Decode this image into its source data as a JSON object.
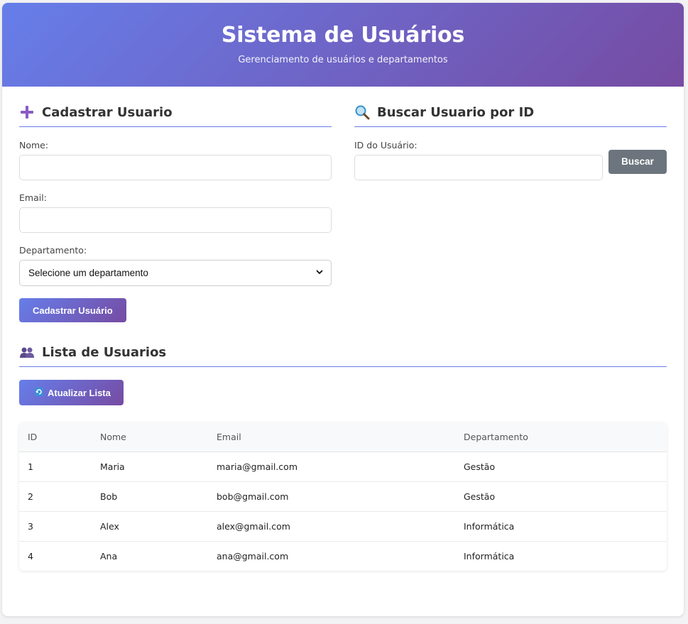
{
  "header": {
    "title": "Sistema de Usuários",
    "subtitle": "Gerenciamento de usuários e departamentos"
  },
  "register": {
    "title": "Cadastrar Usuario",
    "icon": "plus-icon",
    "name_label": "Nome:",
    "name_value": "",
    "email_label": "Email:",
    "email_value": "",
    "department_label": "Departamento:",
    "department_selected": "Selecione um departamento",
    "submit_label": "Cadastrar Usuário"
  },
  "search": {
    "title": "Buscar Usuario por ID",
    "icon": "magnifier-icon",
    "id_label": "ID do Usuário:",
    "id_value": "",
    "button_label": "Buscar"
  },
  "list": {
    "title": "Lista de Usuarios",
    "icon": "users-icon",
    "refresh_label": "Atualizar Lista",
    "refresh_icon": "refresh-icon",
    "columns": [
      "ID",
      "Nome",
      "Email",
      "Departamento"
    ],
    "rows": [
      {
        "id": "1",
        "nome": "Maria",
        "email": "maria@gmail.com",
        "departamento": "Gestão"
      },
      {
        "id": "2",
        "nome": "Bob",
        "email": "bob@gmail.com",
        "departamento": "Gestão"
      },
      {
        "id": "3",
        "nome": "Alex",
        "email": "alex@gmail.com",
        "departamento": "Informática"
      },
      {
        "id": "4",
        "nome": "Ana",
        "email": "ana@gmail.com",
        "departamento": "Informática"
      }
    ]
  },
  "colors": {
    "gradient_start": "#667eea",
    "gradient_end": "#764ba2",
    "secondary_button": "#6c757d"
  }
}
